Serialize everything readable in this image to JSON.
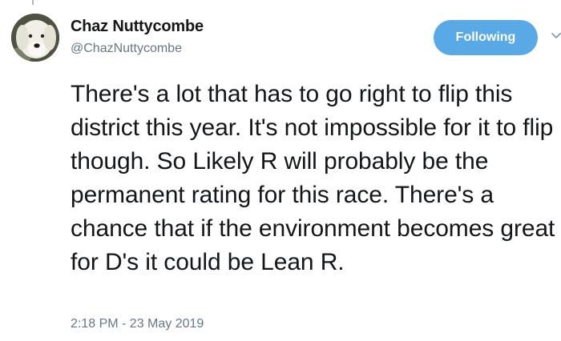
{
  "tweet": {
    "author_name": "Chaz Nuttycombe",
    "author_handle": "@ChazNuttycombe",
    "follow_label": "Following",
    "text": "There's a lot that has to go right to flip this district this year. It's not impossible for it to flip though. So Likely R will probably be the permanent rating for this race. There's a chance that if the environment becomes great for D's it could be Lean R.",
    "timestamp": "2:18 PM - 23 May 2019"
  },
  "icons": {
    "avatar": "dog-avatar",
    "menu": "chevron-down-icon"
  },
  "colors": {
    "follow_button": "#58a9e6",
    "secondary_text": "#657786",
    "primary_text": "#14171a"
  }
}
